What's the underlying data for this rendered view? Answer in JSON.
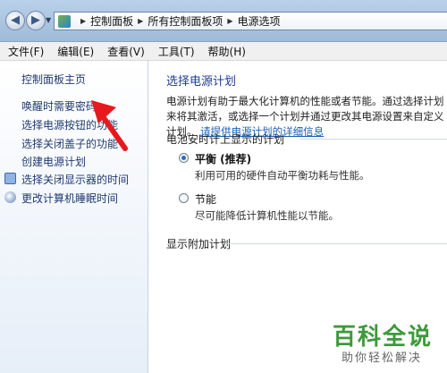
{
  "address": {
    "crumbs": [
      "控制面板",
      "所有控制面板项",
      "电源选项"
    ]
  },
  "menubar": {
    "items": [
      "文件(F)",
      "编辑(E)",
      "查看(V)",
      "工具(T)",
      "帮助(H)"
    ]
  },
  "sidebar": {
    "items": [
      {
        "label": "控制面板主页"
      },
      {
        "label": "唤醒时需要密码"
      },
      {
        "label": "选择电源按钮的功能"
      },
      {
        "label": "选择关闭盖子的功能"
      },
      {
        "label": "创建电源计划"
      },
      {
        "label": "选择关闭显示器的时间",
        "icon": "monitor-icon"
      },
      {
        "label": "更改计算机睡眠时间",
        "icon": "moon-icon"
      }
    ]
  },
  "main": {
    "title": "选择电源计划",
    "description": "电源计划有助于最大化计算机的性能或者节能。通过选择计划来将其激活，或选择一个计划并通过更改其电源设置来自定义计划。",
    "description_link": "请提供电源计划的详细信息",
    "battery_section": "电池安时计上显示的计划",
    "plans": [
      {
        "name": "平衡 (推荐)",
        "desc": "利用可用的硬件自动平衡功耗与性能。",
        "selected": true
      },
      {
        "name": "节能",
        "desc": "尽可能降低计算机性能以节能。",
        "selected": false
      }
    ],
    "additional_section": "显示附加计划"
  },
  "watermark": {
    "logo": "百科全说",
    "sub": "助你轻松解决"
  },
  "colors": {
    "link": "#1f3b71",
    "title": "#1e3d8f",
    "arrow": "#e8181f",
    "watermark": "#3d9a3a"
  }
}
